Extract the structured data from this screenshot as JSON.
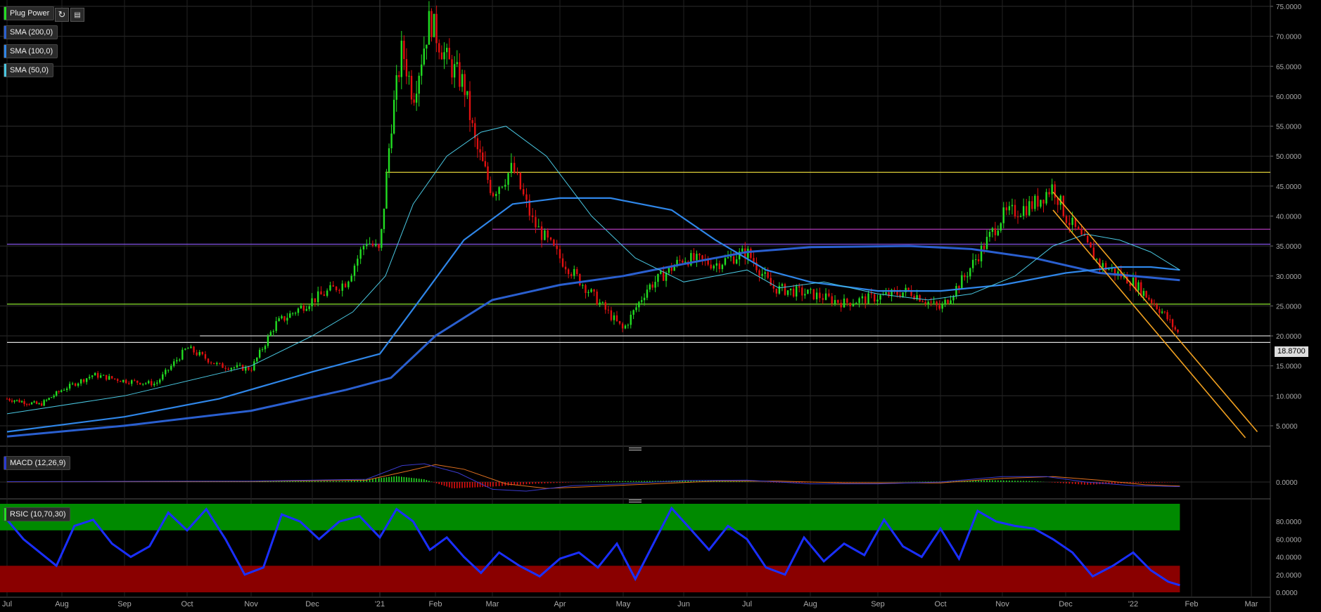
{
  "chart_data": {
    "type": "candlestick",
    "title": "Plug Power",
    "x_labels": [
      "Jul",
      "Aug",
      "Sep",
      "Oct",
      "Nov",
      "Dec",
      "'21",
      "Feb",
      "Mar",
      "Apr",
      "May",
      "Jun",
      "Jul",
      "Aug",
      "Sep",
      "Oct",
      "Nov",
      "Dec",
      "'22",
      "Feb",
      "Mar"
    ],
    "price_axis": {
      "ticks": [
        "75.0000",
        "70.0000",
        "65.0000",
        "60.0000",
        "55.0000",
        "50.0000",
        "45.0000",
        "40.0000",
        "35.0000",
        "30.0000",
        "25.0000",
        "20.0000",
        "15.0000",
        "10.0000",
        "5.0000"
      ],
      "ylim": [
        3,
        75
      ],
      "last_price_label": "18.8700",
      "last_price": 18.87
    },
    "indicators": [
      "SMA (200,0)",
      "SMA (100,0)",
      "SMA (50,0)"
    ],
    "sma_colors": {
      "sma200": "#2a5fcf",
      "sma100": "#2f86e8",
      "sma50": "#49c6e0"
    },
    "price_series": [
      {
        "t": 0,
        "v": 9.5
      },
      {
        "t": 0.6,
        "v": 8.5
      },
      {
        "t": 1.0,
        "v": 11
      },
      {
        "t": 1.5,
        "v": 13.5
      },
      {
        "t": 2.0,
        "v": 12.5
      },
      {
        "t": 2.5,
        "v": 12
      },
      {
        "t": 3.0,
        "v": 18
      },
      {
        "t": 3.5,
        "v": 15
      },
      {
        "t": 4.0,
        "v": 14.5
      },
      {
        "t": 4.4,
        "v": 22
      },
      {
        "t": 5.0,
        "v": 26
      },
      {
        "t": 5.5,
        "v": 29
      },
      {
        "t": 5.8,
        "v": 36
      },
      {
        "t": 6.0,
        "v": 34
      },
      {
        "t": 6.2,
        "v": 55
      },
      {
        "t": 6.4,
        "v": 68
      },
      {
        "t": 6.6,
        "v": 60
      },
      {
        "t": 6.9,
        "v": 73
      },
      {
        "t": 7.2,
        "v": 66
      },
      {
        "t": 7.5,
        "v": 62
      },
      {
        "t": 7.7,
        "v": 52
      },
      {
        "t": 8.0,
        "v": 44
      },
      {
        "t": 8.3,
        "v": 48
      },
      {
        "t": 8.6,
        "v": 39
      },
      {
        "t": 9.0,
        "v": 33
      },
      {
        "t": 9.5,
        "v": 27
      },
      {
        "t": 10.0,
        "v": 21
      },
      {
        "t": 10.4,
        "v": 28
      },
      {
        "t": 11.0,
        "v": 33
      },
      {
        "t": 11.5,
        "v": 32
      },
      {
        "t": 12.0,
        "v": 34
      },
      {
        "t": 12.4,
        "v": 28
      },
      {
        "t": 13.0,
        "v": 27
      },
      {
        "t": 13.5,
        "v": 25.5
      },
      {
        "t": 14.0,
        "v": 26.5
      },
      {
        "t": 14.5,
        "v": 27.5
      },
      {
        "t": 15.0,
        "v": 24.5
      },
      {
        "t": 15.4,
        "v": 30
      },
      {
        "t": 16.0,
        "v": 40
      },
      {
        "t": 16.5,
        "v": 42
      },
      {
        "t": 16.8,
        "v": 45
      },
      {
        "t": 17.0,
        "v": 40
      },
      {
        "t": 17.5,
        "v": 32
      },
      {
        "t": 18.0,
        "v": 29
      },
      {
        "t": 18.5,
        "v": 24
      },
      {
        "t": 18.8,
        "v": 20
      }
    ],
    "sma50": [
      {
        "t": 0,
        "v": 7
      },
      {
        "t": 2,
        "v": 10
      },
      {
        "t": 4,
        "v": 15
      },
      {
        "t": 5,
        "v": 20
      },
      {
        "t": 5.6,
        "v": 24
      },
      {
        "t": 6.1,
        "v": 30
      },
      {
        "t": 6.6,
        "v": 42
      },
      {
        "t": 7.2,
        "v": 50
      },
      {
        "t": 7.8,
        "v": 54
      },
      {
        "t": 8.2,
        "v": 55
      },
      {
        "t": 8.8,
        "v": 50
      },
      {
        "t": 9.5,
        "v": 40
      },
      {
        "t": 10.2,
        "v": 33
      },
      {
        "t": 11.0,
        "v": 29
      },
      {
        "t": 11.5,
        "v": 30
      },
      {
        "t": 12.0,
        "v": 31
      },
      {
        "t": 12.5,
        "v": 28
      },
      {
        "t": 13.2,
        "v": 29
      },
      {
        "t": 14.0,
        "v": 27
      },
      {
        "t": 14.8,
        "v": 26
      },
      {
        "t": 15.5,
        "v": 27
      },
      {
        "t": 16.2,
        "v": 30
      },
      {
        "t": 16.8,
        "v": 35
      },
      {
        "t": 17.3,
        "v": 37
      },
      {
        "t": 17.8,
        "v": 36
      },
      {
        "t": 18.3,
        "v": 34
      },
      {
        "t": 18.8,
        "v": 31
      }
    ],
    "sma100": [
      {
        "t": 0,
        "v": 4
      },
      {
        "t": 2,
        "v": 6.5
      },
      {
        "t": 3.5,
        "v": 9.5
      },
      {
        "t": 5,
        "v": 14
      },
      {
        "t": 6,
        "v": 17
      },
      {
        "t": 6.8,
        "v": 27
      },
      {
        "t": 7.5,
        "v": 36
      },
      {
        "t": 8.3,
        "v": 42
      },
      {
        "t": 9,
        "v": 43
      },
      {
        "t": 9.8,
        "v": 43
      },
      {
        "t": 10.8,
        "v": 41
      },
      {
        "t": 11.5,
        "v": 36
      },
      {
        "t": 12.3,
        "v": 31
      },
      {
        "t": 13,
        "v": 29
      },
      {
        "t": 14,
        "v": 27.5
      },
      {
        "t": 15,
        "v": 27.5
      },
      {
        "t": 16,
        "v": 28.5
      },
      {
        "t": 17,
        "v": 30.5
      },
      {
        "t": 17.8,
        "v": 31.5
      },
      {
        "t": 18.3,
        "v": 31.5
      },
      {
        "t": 18.8,
        "v": 31
      }
    ],
    "sma200": [
      {
        "t": 0,
        "v": 3.2
      },
      {
        "t": 2,
        "v": 5
      },
      {
        "t": 4,
        "v": 7.5
      },
      {
        "t": 5.5,
        "v": 11
      },
      {
        "t": 6.2,
        "v": 13
      },
      {
        "t": 7,
        "v": 20
      },
      {
        "t": 8,
        "v": 26
      },
      {
        "t": 9,
        "v": 28.5
      },
      {
        "t": 10,
        "v": 30
      },
      {
        "t": 11,
        "v": 32
      },
      {
        "t": 12,
        "v": 34
      },
      {
        "t": 13,
        "v": 34.8
      },
      {
        "t": 14.5,
        "v": 35
      },
      {
        "t": 15.5,
        "v": 34.5
      },
      {
        "t": 16.5,
        "v": 33
      },
      {
        "t": 17.5,
        "v": 30.5
      },
      {
        "t": 18.8,
        "v": 29.3
      }
    ],
    "hlines": [
      {
        "v": 47.3,
        "color": "#e0d23a",
        "t_start": 6.1
      },
      {
        "v": 37.8,
        "color": "#b03ab8",
        "t_start": 8.0
      },
      {
        "v": 35.3,
        "color": "#7a4cd6",
        "t_start": 0
      },
      {
        "v": 25.3,
        "color": "#7fcf2a",
        "t_start": 0
      },
      {
        "v": 20.0,
        "color": "#cccccc",
        "t_start": 3.2
      },
      {
        "v": 18.9,
        "color": "#dddddd",
        "t_start": 0
      }
    ],
    "channel": {
      "color": "#f0a020",
      "upper": [
        {
          "t": 16.8,
          "v": 44
        },
        {
          "t": 20.1,
          "v": 4
        }
      ],
      "lower": [
        {
          "t": 16.8,
          "v": 41
        },
        {
          "t": 19.9,
          "v": 3
        }
      ]
    },
    "macd": {
      "label": "MACD (12,26,9)",
      "tick": "0.0000",
      "histogram": [
        {
          "t": 0,
          "v": 0.1
        },
        {
          "t": 2,
          "v": 0.2
        },
        {
          "t": 4,
          "v": 0.4
        },
        {
          "t": 5.5,
          "v": 0.5
        },
        {
          "t": 6.3,
          "v": 3.2
        },
        {
          "t": 6.8,
          "v": 1.5
        },
        {
          "t": 7.3,
          "v": -3.5
        },
        {
          "t": 8.0,
          "v": -2.5
        },
        {
          "t": 8.6,
          "v": -1.0
        },
        {
          "t": 9.5,
          "v": 0.3
        },
        {
          "t": 10.5,
          "v": 0.6
        },
        {
          "t": 11.5,
          "v": 0.8
        },
        {
          "t": 12.5,
          "v": -0.4
        },
        {
          "t": 13.5,
          "v": -0.2
        },
        {
          "t": 15.0,
          "v": 0.3
        },
        {
          "t": 15.8,
          "v": 1.0
        },
        {
          "t": 16.5,
          "v": 0.5
        },
        {
          "t": 17.3,
          "v": -1.5
        },
        {
          "t": 18.0,
          "v": -0.5
        },
        {
          "t": 18.8,
          "v": -0.1
        }
      ],
      "macd_line": [
        {
          "t": 0,
          "v": 0.2
        },
        {
          "t": 4,
          "v": 0.5
        },
        {
          "t": 5.8,
          "v": 1.5
        },
        {
          "t": 6.4,
          "v": 9
        },
        {
          "t": 6.8,
          "v": 10
        },
        {
          "t": 7.4,
          "v": 5
        },
        {
          "t": 8.0,
          "v": -4
        },
        {
          "t": 8.5,
          "v": -5
        },
        {
          "t": 9.2,
          "v": -2
        },
        {
          "t": 10,
          "v": -1
        },
        {
          "t": 11,
          "v": 0.8
        },
        {
          "t": 12,
          "v": 1
        },
        {
          "t": 13,
          "v": -1
        },
        {
          "t": 14,
          "v": -1
        },
        {
          "t": 15,
          "v": 0
        },
        {
          "t": 16,
          "v": 3
        },
        {
          "t": 16.7,
          "v": 3
        },
        {
          "t": 17.3,
          "v": 0
        },
        {
          "t": 18,
          "v": -2
        },
        {
          "t": 18.8,
          "v": -2.5
        }
      ],
      "signal_line": [
        {
          "t": 0,
          "v": 0.1
        },
        {
          "t": 4,
          "v": 0.3
        },
        {
          "t": 5.8,
          "v": 1
        },
        {
          "t": 6.5,
          "v": 6
        },
        {
          "t": 7.0,
          "v": 9.5
        },
        {
          "t": 7.5,
          "v": 7
        },
        {
          "t": 8.2,
          "v": -1
        },
        {
          "t": 8.8,
          "v": -3.5
        },
        {
          "t": 9.5,
          "v": -2.5
        },
        {
          "t": 10.5,
          "v": -1
        },
        {
          "t": 11.5,
          "v": 0.5
        },
        {
          "t": 12.5,
          "v": 0.5
        },
        {
          "t": 13.5,
          "v": -0.5
        },
        {
          "t": 15,
          "v": -0.5
        },
        {
          "t": 16,
          "v": 2
        },
        {
          "t": 16.8,
          "v": 3
        },
        {
          "t": 17.5,
          "v": 1
        },
        {
          "t": 18.2,
          "v": -1.5
        },
        {
          "t": 18.8,
          "v": -2.2
        }
      ]
    },
    "rsic": {
      "label": "RSIC (10,70,30)",
      "ticks": [
        "80.0000",
        "60.0000",
        "40.0000",
        "20.0000",
        "0.0000"
      ],
      "upper": 70,
      "lower": 30,
      "series": [
        {
          "t": 0.0,
          "v": 82
        },
        {
          "t": 0.3,
          "v": 60
        },
        {
          "t": 0.6,
          "v": 45
        },
        {
          "t": 0.9,
          "v": 30
        },
        {
          "t": 1.2,
          "v": 75
        },
        {
          "t": 1.5,
          "v": 82
        },
        {
          "t": 1.8,
          "v": 55
        },
        {
          "t": 2.1,
          "v": 40
        },
        {
          "t": 2.4,
          "v": 52
        },
        {
          "t": 2.7,
          "v": 90
        },
        {
          "t": 3.0,
          "v": 70
        },
        {
          "t": 3.3,
          "v": 94
        },
        {
          "t": 3.6,
          "v": 60
        },
        {
          "t": 3.9,
          "v": 20
        },
        {
          "t": 4.2,
          "v": 28
        },
        {
          "t": 4.5,
          "v": 88
        },
        {
          "t": 4.8,
          "v": 80
        },
        {
          "t": 5.1,
          "v": 60
        },
        {
          "t": 5.4,
          "v": 80
        },
        {
          "t": 5.7,
          "v": 86
        },
        {
          "t": 6.0,
          "v": 62
        },
        {
          "t": 6.3,
          "v": 94
        },
        {
          "t": 6.6,
          "v": 80
        },
        {
          "t": 6.9,
          "v": 48
        },
        {
          "t": 7.2,
          "v": 62
        },
        {
          "t": 7.5,
          "v": 40
        },
        {
          "t": 7.8,
          "v": 22
        },
        {
          "t": 8.1,
          "v": 45
        },
        {
          "t": 8.4,
          "v": 30
        },
        {
          "t": 8.7,
          "v": 18
        },
        {
          "t": 9.0,
          "v": 38
        },
        {
          "t": 9.3,
          "v": 45
        },
        {
          "t": 9.6,
          "v": 28
        },
        {
          "t": 9.9,
          "v": 55
        },
        {
          "t": 10.2,
          "v": 15
        },
        {
          "t": 10.5,
          "v": 55
        },
        {
          "t": 10.8,
          "v": 95
        },
        {
          "t": 11.1,
          "v": 72
        },
        {
          "t": 11.4,
          "v": 48
        },
        {
          "t": 11.7,
          "v": 75
        },
        {
          "t": 12.0,
          "v": 60
        },
        {
          "t": 12.3,
          "v": 28
        },
        {
          "t": 12.6,
          "v": 20
        },
        {
          "t": 12.9,
          "v": 62
        },
        {
          "t": 13.2,
          "v": 35
        },
        {
          "t": 13.5,
          "v": 55
        },
        {
          "t": 13.8,
          "v": 42
        },
        {
          "t": 14.1,
          "v": 82
        },
        {
          "t": 14.4,
          "v": 52
        },
        {
          "t": 14.7,
          "v": 40
        },
        {
          "t": 15.0,
          "v": 72
        },
        {
          "t": 15.3,
          "v": 38
        },
        {
          "t": 15.6,
          "v": 92
        },
        {
          "t": 15.9,
          "v": 80
        },
        {
          "t": 16.2,
          "v": 75
        },
        {
          "t": 16.5,
          "v": 72
        },
        {
          "t": 16.8,
          "v": 60
        },
        {
          "t": 17.1,
          "v": 45
        },
        {
          "t": 17.4,
          "v": 18
        },
        {
          "t": 17.7,
          "v": 30
        },
        {
          "t": 18.0,
          "v": 45
        },
        {
          "t": 18.3,
          "v": 25
        },
        {
          "t": 18.6,
          "v": 12
        },
        {
          "t": 18.8,
          "v": 8
        }
      ]
    }
  },
  "header": {
    "symbol_label": "Plug Power",
    "refresh_icon": "refresh-icon",
    "settings_icon": "chart-settings-icon"
  },
  "colors": {
    "up": "#22dd22",
    "down": "#e01010",
    "rsi_line": "#1a2fff",
    "macd_line": "#3a3acc",
    "signal_line": "#e07020"
  }
}
